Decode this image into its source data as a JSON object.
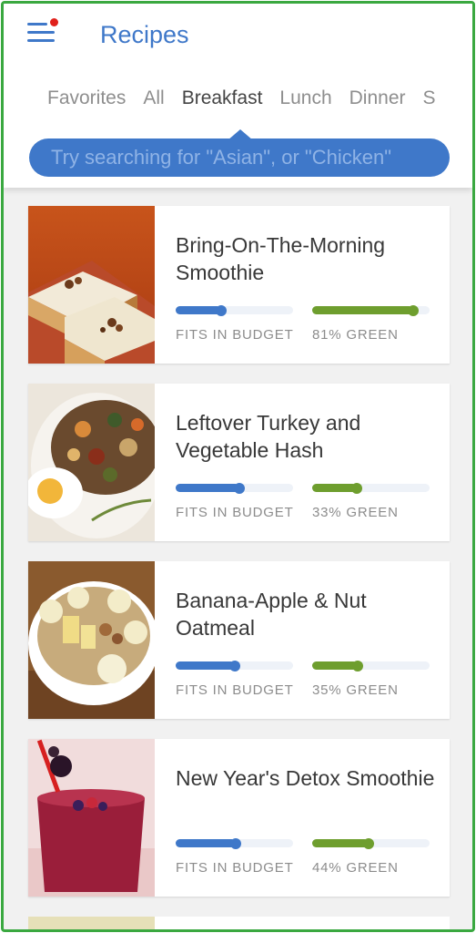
{
  "app": {
    "title": "Recipes"
  },
  "header": {
    "menu_icon": "hamburger-menu-icon",
    "notification_dot_color": "#e0201b"
  },
  "tabs": [
    {
      "label": "Favorites",
      "active": false
    },
    {
      "label": "All",
      "active": false
    },
    {
      "label": "Breakfast",
      "active": true
    },
    {
      "label": "Lunch",
      "active": false
    },
    {
      "label": "Dinner",
      "active": false
    },
    {
      "label": "S",
      "active": false
    }
  ],
  "search": {
    "placeholder": "Try searching for \"Asian\", or \"Chicken\"",
    "value": ""
  },
  "colors": {
    "accent": "#3f78c9",
    "green": "#6e9e2e",
    "frame": "#3aa840"
  },
  "recipes": [
    {
      "name": "Bring-On-The-Morning Smoothie",
      "budget_fraction": 0.39,
      "budget_label": "FITS IN BUDGET",
      "green_fraction": 0.86,
      "green_label": "81% GREEN",
      "image": "cake-bars-photo"
    },
    {
      "name": "Leftover Turkey and Vegetable Hash",
      "budget_fraction": 0.54,
      "budget_label": "FITS IN BUDGET",
      "green_fraction": 0.38,
      "green_label": "33% GREEN",
      "image": "turkey-hash-photo"
    },
    {
      "name": "Banana-Apple & Nut Oatmeal",
      "budget_fraction": 0.5,
      "budget_label": "FITS IN BUDGET",
      "green_fraction": 0.39,
      "green_label": "35% GREEN",
      "image": "oatmeal-bowl-photo"
    },
    {
      "name": "New Year's Detox Smoothie",
      "budget_fraction": 0.51,
      "budget_label": "FITS IN BUDGET",
      "green_fraction": 0.48,
      "green_label": "44% GREEN",
      "image": "berry-smoothie-photo"
    }
  ]
}
